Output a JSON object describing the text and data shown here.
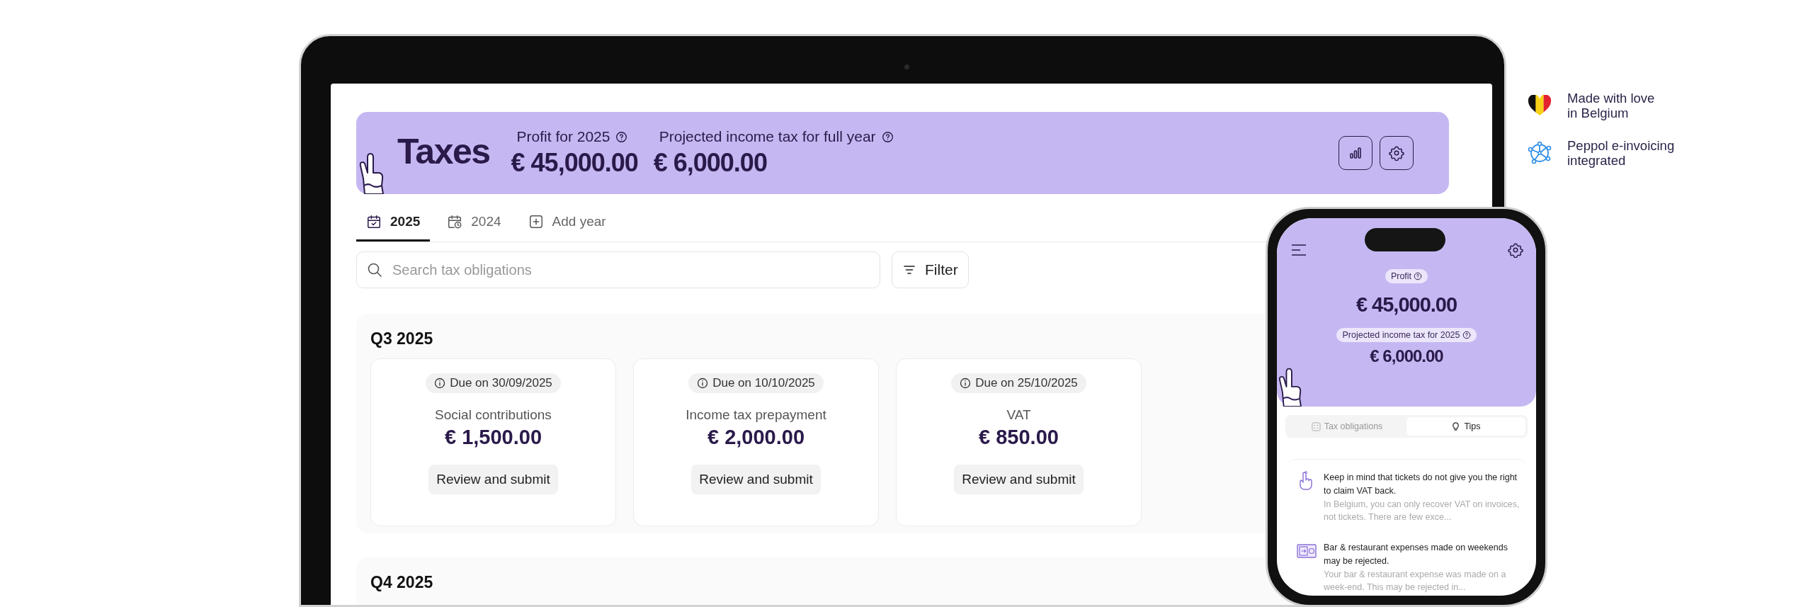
{
  "laptop": {
    "header": {
      "title": "Taxes",
      "stats": [
        {
          "label": "Profit for 2025",
          "value": "€ 45,000.00"
        },
        {
          "label": "Projected income tax for full year",
          "value": "€ 6,000.00"
        }
      ]
    },
    "tabs": [
      {
        "label": "2025",
        "selected": true,
        "kind": "calendar"
      },
      {
        "label": "2024",
        "selected": false,
        "kind": "history"
      },
      {
        "label": "Add year",
        "selected": false,
        "kind": "add"
      }
    ],
    "search": {
      "placeholder": "Search tax obligations"
    },
    "filter_button": "Filter",
    "quarters": [
      {
        "title": "Q3 2025",
        "obligations": [
          {
            "due": "Due on 30/09/2025",
            "name": "Social contributions",
            "amount": "€ 1,500.00",
            "action": "Review and submit"
          },
          {
            "due": "Due on 10/10/2025",
            "name": "Income tax prepayment",
            "amount": "€ 2,000.00",
            "action": "Review and submit"
          },
          {
            "due": "Due on 25/10/2025",
            "name": "VAT",
            "amount": "€ 850.00",
            "action": "Review and submit"
          }
        ]
      },
      {
        "title": "Q4 2025"
      }
    ]
  },
  "phone": {
    "profit_label": "Profit",
    "profit": "€ 45,000.00",
    "tax_label": "Projected income tax for 2025",
    "tax": "€ 6,000.00",
    "tabs": [
      {
        "label": "Tax obligations",
        "selected": false,
        "kind": "list"
      },
      {
        "label": "Tips",
        "selected": true,
        "kind": "bulb"
      }
    ],
    "tips": [
      {
        "kind": "finger",
        "title": "Keep in mind that tickets do not give you the right to claim VAT back.",
        "body": "In Belgium, you can only recover VAT on invoices, not tickets. There are few exce..."
      },
      {
        "kind": "safe",
        "title": "Bar & restaurant expenses made on weekends may be rejected.",
        "body": "Your bar & restaurant expense was made on a week-end. This may be rejected in..."
      }
    ]
  },
  "badges": [
    {
      "kind": "heart",
      "text": "Made with love\nin Belgium"
    },
    {
      "kind": "network",
      "text": "Peppol e-invoicing\nintegrated"
    }
  ]
}
